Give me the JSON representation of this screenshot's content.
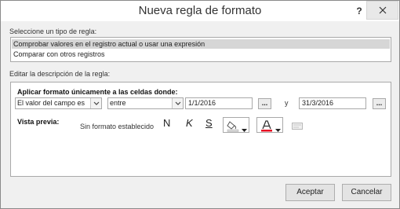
{
  "window": {
    "title": "Nueva regla de formato",
    "help_label": "?"
  },
  "rule_type": {
    "label": "Seleccione un tipo de regla:",
    "items": [
      "Comprobar valores en el registro actual o usar una expresión",
      "Comparar con otros registros"
    ],
    "selected_index": 0
  },
  "rule_description": {
    "label": "Editar la descripción de la regla:",
    "apply_heading": "Aplicar formato únicamente a las celdas donde:",
    "field_condition": "El valor del campo es",
    "operator": "entre",
    "value1": "1/1/2016",
    "and_label": "y",
    "value2": "31/3/2016",
    "ellipsis_label": "...",
    "preview_label": "Vista previa:",
    "preview_text": "Sin formato establecido",
    "bold_label": "N",
    "italic_label": "K",
    "underline_label": "S",
    "fill_color_icon": "paint-bucket-icon",
    "font_color_icon": "font-color-icon",
    "font_color_value": "#e81123",
    "enable_icon": "toggle-format-icon"
  },
  "buttons": {
    "accept": "Aceptar",
    "cancel": "Cancelar"
  }
}
